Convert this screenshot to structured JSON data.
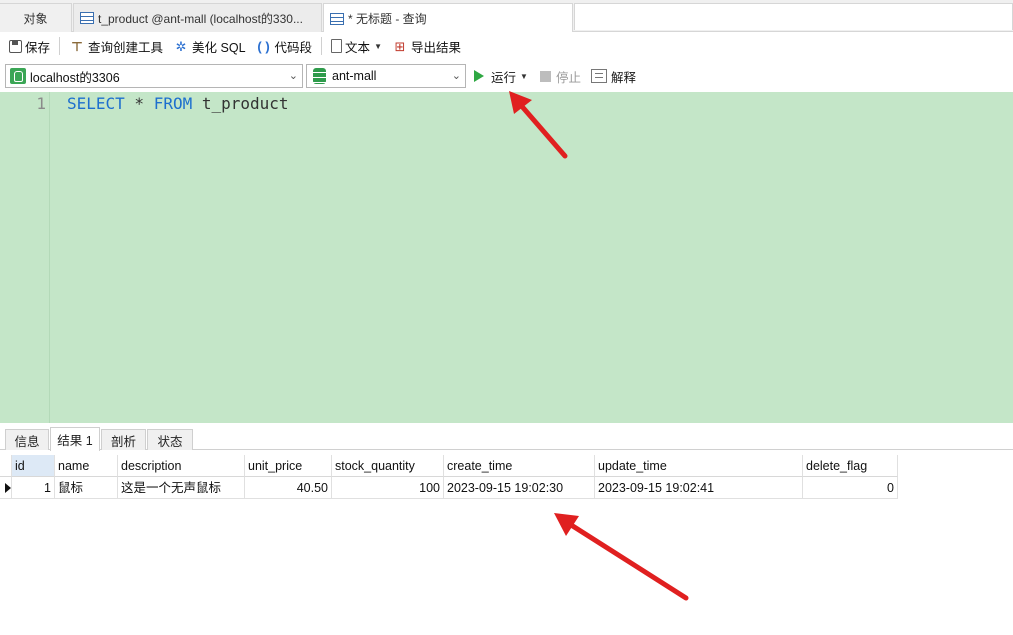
{
  "tabs": {
    "objects": "对象",
    "product": "t_product @ant-mall (localhost的330...",
    "query": "* 无标题 - 查询"
  },
  "toolbar": {
    "save": "保存",
    "query_builder": "查询创建工具",
    "beautify": "美化 SQL",
    "snippet": "代码段",
    "text": "文本",
    "export": "导出结果"
  },
  "connection": {
    "server": "localhost的3306",
    "database": "ant-mall",
    "run": "运行",
    "stop": "停止",
    "explain": "解释"
  },
  "editor": {
    "line": "1",
    "kw_select": "SELECT",
    "star": " * ",
    "kw_from": "FROM",
    "table": " t_product"
  },
  "bottom_tabs": {
    "info": "信息",
    "result": "结果 1",
    "profile": "剖析",
    "status": "状态"
  },
  "grid": {
    "columns": [
      "id",
      "name",
      "description",
      "unit_price",
      "stock_quantity",
      "create_time",
      "update_time",
      "delete_flag"
    ],
    "rows": [
      [
        "1",
        "鼠标",
        "这是一个无声鼠标",
        "40.50",
        "100",
        "2023-09-15 19:02:30",
        "2023-09-15 19:02:41",
        "0"
      ]
    ]
  },
  "colors": {
    "editor_bg": "#c4e6c8",
    "keyword": "#1d6fce",
    "arrow": "#e02020"
  }
}
